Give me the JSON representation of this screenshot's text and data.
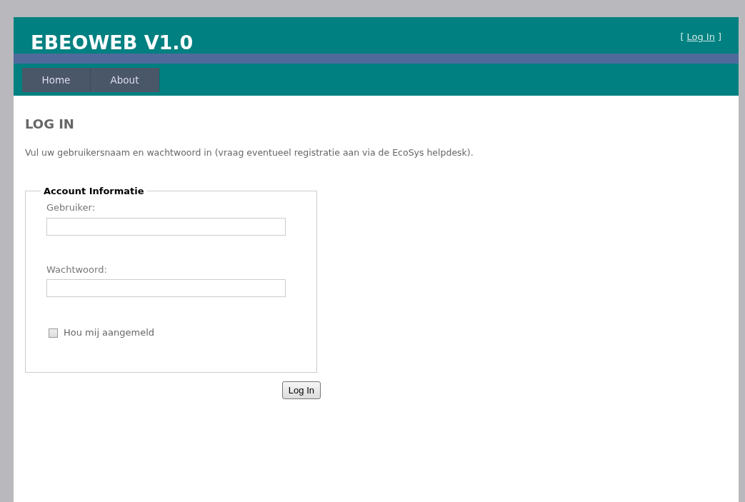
{
  "header": {
    "title": "EBEOWEB V1.0",
    "login_prefix": "[",
    "login_link": "Log In",
    "login_suffix": "]"
  },
  "menu": [
    {
      "label": "Home",
      "selected": false
    },
    {
      "label": "About",
      "selected": false
    }
  ],
  "heading": "LOG IN",
  "intro": "Vul uw gebruikersnaam en wachtwoord in (vraag eventueel registratie aan via de EcoSys helpdesk).",
  "fieldset": {
    "legend": "Account Informatie",
    "fields": [
      {
        "label": "Gebruiker:"
      },
      {
        "label": "Wachtwoord:"
      }
    ],
    "remember": {
      "label": "Hou mij aangemeld",
      "checked": false
    }
  },
  "button": "Log In"
}
